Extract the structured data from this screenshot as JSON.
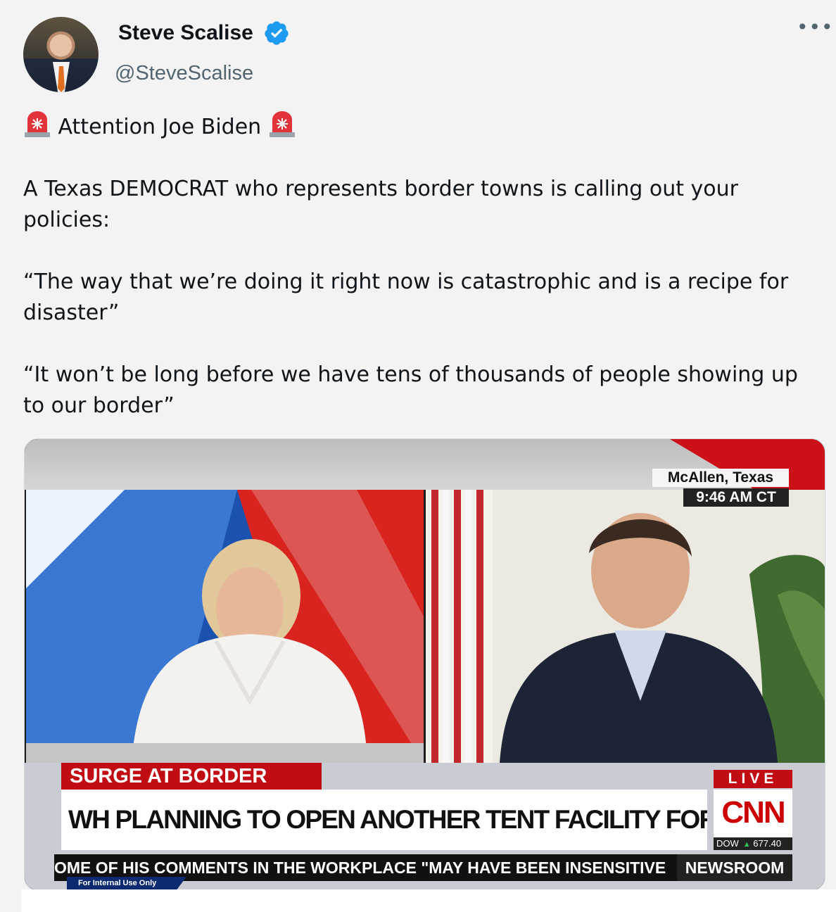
{
  "author": {
    "name": "Steve Scalise",
    "handle": "@SteveScalise",
    "verified": true
  },
  "menu_glyph": "•••",
  "tweet": {
    "line1": "Attention Joe Biden",
    "line1_icon": "police-siren-emoji",
    "para1": "A Texas DEMOCRAT who represents border towns is calling out your policies:",
    "para2": "“The way that we’re doing it right now is catastrophic and is a recipe for disaster”",
    "para3": "“It won’t be long before we have tens of thousands of people showing up to our border”"
  },
  "video": {
    "location": "McAllen, Texas",
    "time": "9:46 AM CT",
    "section_label": "SURGE AT BORDER",
    "headline": "WH PLANNING TO OPEN ANOTHER TENT FACILITY FOR MIGRANTS IN TEXAS",
    "live_label": "LIVE",
    "network": "CNN",
    "dow_label": "DOW",
    "dow_value": "677.40",
    "ticker": "OME OF HIS COMMENTS IN THE WORKPLACE \"MAY HAVE BEEN INSENSITIVE",
    "program": "NEWSROOM",
    "watermark": "For Internal Use Only"
  },
  "colors": {
    "cnn_red": "#cc0000",
    "verified_blue": "#1d9bf0",
    "handle_gray": "#536471"
  }
}
